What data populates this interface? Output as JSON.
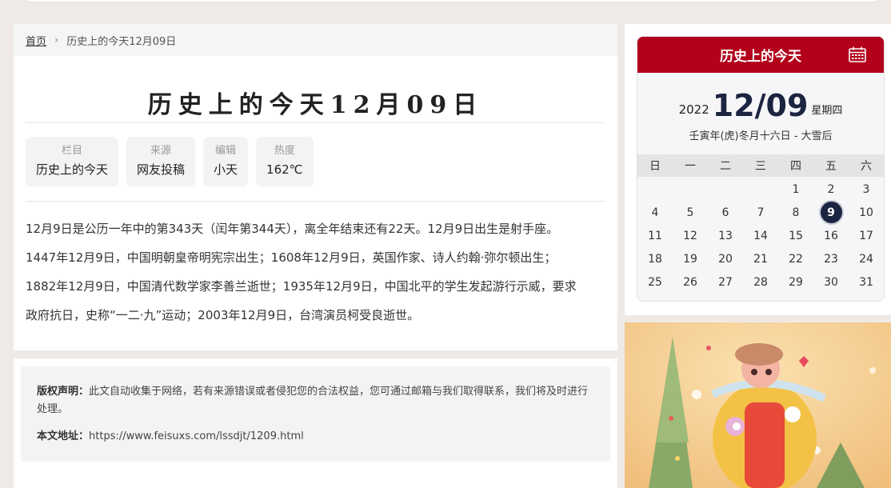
{
  "breadcrumb": {
    "home": "首页",
    "sep": "›",
    "current": "历史上的今天12月09日"
  },
  "article": {
    "title": "历史上的今天12月09日",
    "meta": [
      {
        "key": "栏目",
        "value": "历史上的今天"
      },
      {
        "key": "来源",
        "value": "网友投稿"
      },
      {
        "key": "编辑",
        "value": "小天"
      },
      {
        "key": "热度",
        "value": "162℃"
      }
    ],
    "lines": [
      "12月9日是公历一年中的第343天（闰年第344天），离全年结束还有22天。12月9日出生是射手座。",
      "1447年12月9日，中国明朝皇帝明宪宗出生；1608年12月9日，英国作家、诗人约翰·弥尔顿出生；",
      "1882年12月9日，中国清代数学家李善兰逝世；1935年12月9日，中国北平的学生发起游行示威，要求",
      "政府抗日，史称“一二·九”运动；2003年12月9日，台湾演员柯受良逝世。"
    ]
  },
  "copyright": {
    "label1": "版权声明：",
    "text1": "此文自动收集于网络，若有来源错误或者侵犯您的合法权益，您可通过邮箱与我们取得联系，我们将及时进行处理。",
    "label2": "本文地址：",
    "url": "https://www.feisuxs.com/lssdjt/1209.html"
  },
  "calendar": {
    "header": "历史上的今天",
    "year": "2022",
    "monthday": "12/09",
    "weekday": "星期四",
    "lunar": "壬寅年(虎)冬月十六日 - 大雪后",
    "weekdays": [
      "日",
      "一",
      "二",
      "三",
      "四",
      "五",
      "六"
    ],
    "leading_blanks": 4,
    "days": [
      "1",
      "2",
      "3",
      "4",
      "5",
      "6",
      "7",
      "8",
      "9",
      "10",
      "11",
      "12",
      "13",
      "14",
      "15",
      "16",
      "17",
      "18",
      "19",
      "20",
      "21",
      "22",
      "23",
      "24",
      "25",
      "26",
      "27",
      "28",
      "29",
      "30",
      "31"
    ],
    "today": "9",
    "accent": "#b3001b",
    "today_color": "#1b2440"
  }
}
